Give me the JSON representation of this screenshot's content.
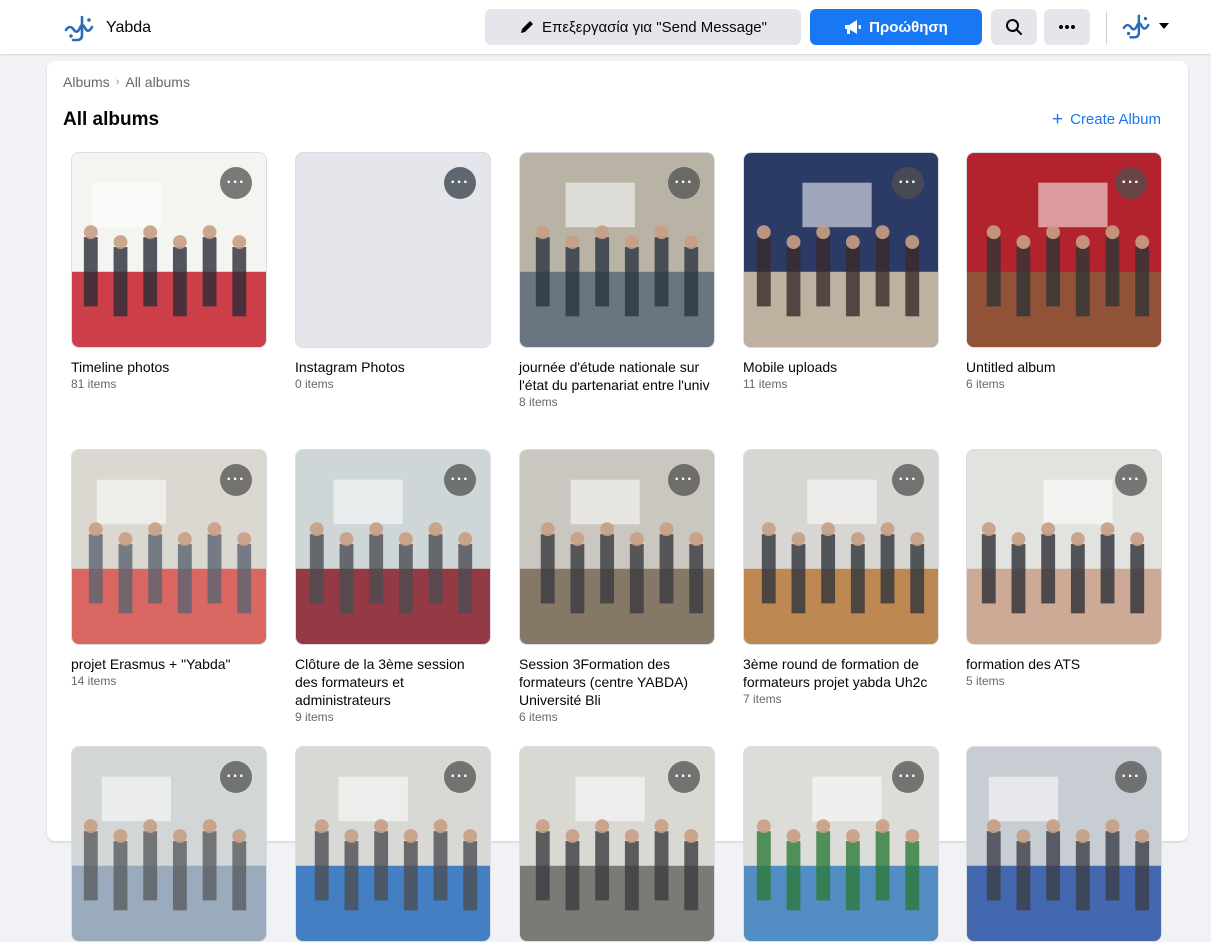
{
  "header": {
    "brand_name": "Yabda",
    "edit_label": "Επεξεργασία για \"Send Message\"",
    "promote_label": "Προώθηση",
    "accent": "#1877f2"
  },
  "breadcrumb": {
    "root": "Albums",
    "current": "All albums"
  },
  "page": {
    "title": "All albums",
    "create_label": "Create Album"
  },
  "albums": [
    {
      "title": "Timeline photos",
      "count": "81 items",
      "palette": [
        "#f4f4f0",
        "#c41f2a",
        "#2a2d3a"
      ]
    },
    {
      "title": "Instagram Photos",
      "count": "0 items",
      "palette": [
        "#e4e6eb",
        "#e4e6eb",
        "#e4e6eb"
      ]
    },
    {
      "title": "journée d'étude nationale sur l'état du partenariat entre l'univ",
      "count": "8 items",
      "palette": [
        "#b9b3a6",
        "#5b6b7b",
        "#2b3340"
      ]
    },
    {
      "title": "Mobile uploads",
      "count": "11 items",
      "palette": [
        "#2c3a66",
        "#d9c7a9",
        "#3b2a2a"
      ]
    },
    {
      "title": "Untitled album",
      "count": "6 items",
      "palette": [
        "#b3232e",
        "#8c5a3a",
        "#2f3436"
      ]
    },
    {
      "title": "projet Erasmus + \"Yabda\"",
      "count": "14 items",
      "palette": [
        "#dad8d0",
        "#d9534f",
        "#5a6470"
      ]
    },
    {
      "title": "Clôture de la 3ème session des formateurs et administrateurs",
      "count": "9 items",
      "palette": [
        "#cfd6d8",
        "#8a1e2a",
        "#4a4e52"
      ]
    },
    {
      "title": "Session 3Formation des formateurs (centre YABDA) Université Bli",
      "count": "6 items",
      "palette": [
        "#c9c7bf",
        "#7a6a56",
        "#3a3a40"
      ]
    },
    {
      "title": "3ème round de formation de formateurs projet yabda Uh2c",
      "count": "7 items",
      "palette": [
        "#d7d6d2",
        "#b97a3c",
        "#30343c"
      ]
    },
    {
      "title": "formation des ATS",
      "count": "5 items",
      "palette": [
        "#e2e2df",
        "#c9a08a",
        "#2d2f36"
      ]
    },
    {
      "title": "",
      "count": "",
      "palette": [
        "#d3d6d6",
        "#8fa3b8",
        "#5a5c5f"
      ]
    },
    {
      "title": "",
      "count": "",
      "palette": [
        "#d8d8d4",
        "#2a6fbf",
        "#4e4f52"
      ]
    },
    {
      "title": "",
      "count": "",
      "palette": [
        "#d9d8d2",
        "#6b6a66",
        "#3b3c40"
      ]
    },
    {
      "title": "",
      "count": "",
      "palette": [
        "#dcdcd8",
        "#3a7fc1",
        "#2d7a3b"
      ]
    },
    {
      "title": "",
      "count": "",
      "palette": [
        "#c8cdd3",
        "#2d56a8",
        "#3c3f47"
      ]
    }
  ]
}
